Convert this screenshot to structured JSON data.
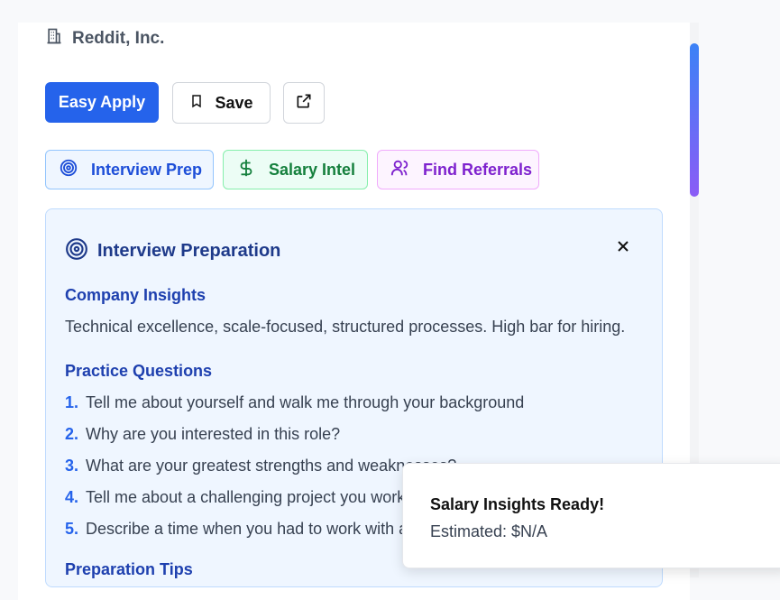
{
  "job": {
    "company": "Reddit, Inc."
  },
  "actions": {
    "apply_label": "Easy Apply",
    "save_label": "Save"
  },
  "tools": [
    {
      "label": "Interview Prep",
      "icon": "target-icon",
      "color": "#1d4ed8"
    },
    {
      "label": "Salary Intel",
      "icon": "dollar-icon",
      "color": "#15803d"
    },
    {
      "label": "Find Referrals",
      "icon": "users-icon",
      "color": "#7e22ce"
    }
  ],
  "prep": {
    "title": "Interview Preparation",
    "insights_heading": "Company Insights",
    "insights_text": "Technical excellence, scale-focused, structured processes. High bar for hiring.",
    "questions_heading": "Practice Questions",
    "questions": [
      {
        "num": "1.",
        "text": "Tell me about yourself and walk me through your background"
      },
      {
        "num": "2.",
        "text": "Why are you interested in this role?"
      },
      {
        "num": "3.",
        "text": "What are your greatest strengths and weaknesses?"
      },
      {
        "num": "4.",
        "text": "Tell me about a challenging project you worked on"
      },
      {
        "num": "5.",
        "text": "Describe a time when you had to work with a difficult"
      }
    ],
    "tips_heading": "Preparation Tips"
  },
  "toast": {
    "title": "Salary Insights Ready!",
    "message": "Estimated: $N/A"
  },
  "colors": {
    "accent": "#2563eb",
    "scroll_gradient_start": "#3b82f6",
    "scroll_gradient_end": "#8b5cf6"
  }
}
